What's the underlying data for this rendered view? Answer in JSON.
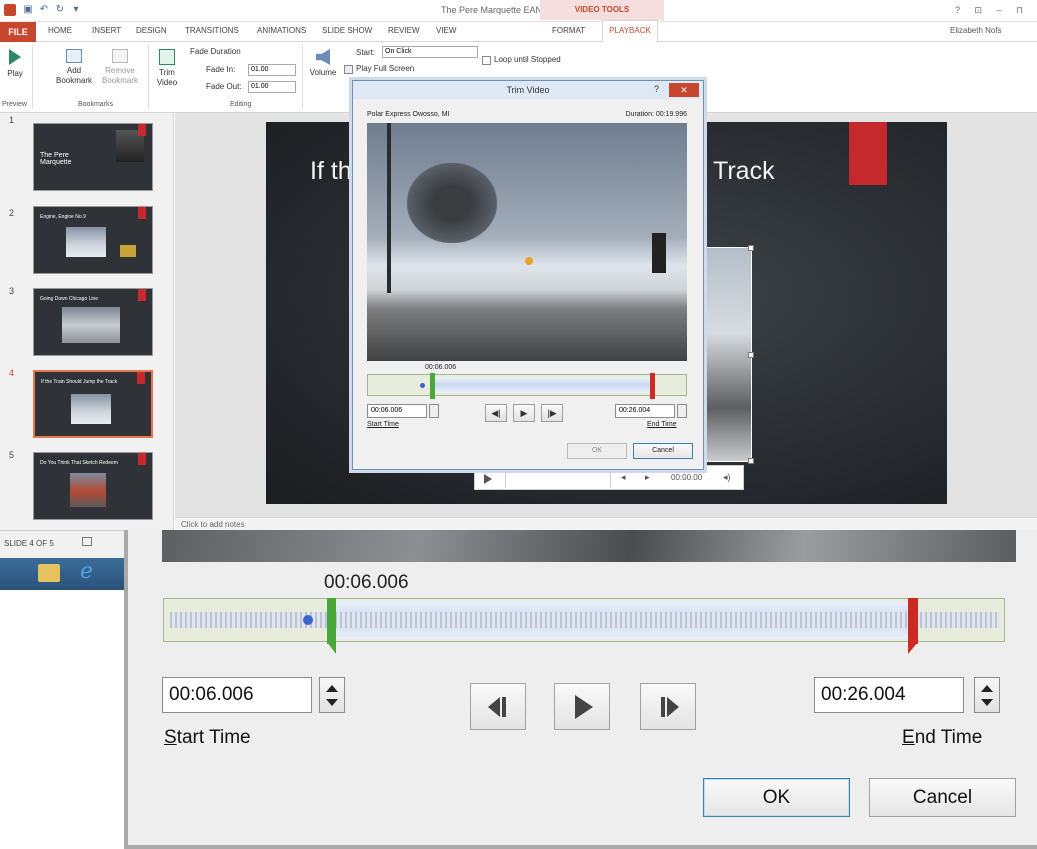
{
  "app": {
    "window_title": "The Pere Marquette EAN - PowerPoint",
    "context_tab_group": "VIDEO TOOLS",
    "user_name": "Elizabeth Nofs",
    "window_controls": "? ⊡ – ⊓"
  },
  "ribbon_tabs": [
    "FILE",
    "HOME",
    "INSERT",
    "DESIGN",
    "TRANSITIONS",
    "ANIMATIONS",
    "SLIDE SHOW",
    "REVIEW",
    "VIEW",
    "FORMAT",
    "PLAYBACK"
  ],
  "ribbon": {
    "play": "Play",
    "add_bookmark": "Add Bookmark",
    "remove_bookmark": "Remove Bookmark",
    "trim_video": "Trim Video",
    "fade_duration": "Fade Duration",
    "fade_in_label": "Fade In:",
    "fade_in_value": "01.00",
    "fade_out_label": "Fade Out:",
    "fade_out_value": "01.00",
    "volume": "Volume",
    "start_label": "Start:",
    "start_value": "On Click",
    "play_full_screen": "Play Full Screen",
    "loop_until_stopped": "Loop until Stopped",
    "group_preview": "Preview",
    "group_bookmarks": "Bookmarks",
    "group_editing": "Editing"
  },
  "slides": [
    {
      "num": "1",
      "label": "The Pere Marquette"
    },
    {
      "num": "2",
      "label": "Engine, Engine No.9"
    },
    {
      "num": "3",
      "label": "Going Down Chicago Line"
    },
    {
      "num": "4",
      "label": "If the Train Should Jump the Track"
    },
    {
      "num": "5",
      "label": "Do You Think That Sketch Redeem"
    }
  ],
  "slide": {
    "title_left": "If th",
    "title_right": "Track",
    "control_time": "00:00.00"
  },
  "notes_placeholder": "Click to add notes",
  "status": {
    "slide_indicator": "SLIDE 4 OF 5"
  },
  "dialog": {
    "title": "Trim Video",
    "help": "?",
    "close": "✕",
    "video_name": "Polar Express Owosso, MI",
    "duration": "Duration: 00:19.996",
    "current_marker": "00:06.006",
    "start_time_value": "00:06.006",
    "start_time_label": "Start Time",
    "end_time_value": "00:26.004",
    "end_time_label": "End Time",
    "ok": "OK",
    "cancel": "Cancel"
  },
  "zoom": {
    "current_marker": "00:06.006",
    "start_time_value": "00:06.006",
    "start_time_label_first": "S",
    "start_time_label_rest": "tart Time",
    "end_time_value": "00:26.004",
    "end_time_label_first": "E",
    "end_time_label_rest": "nd Time",
    "ok": "OK",
    "cancel": "Cancel"
  }
}
